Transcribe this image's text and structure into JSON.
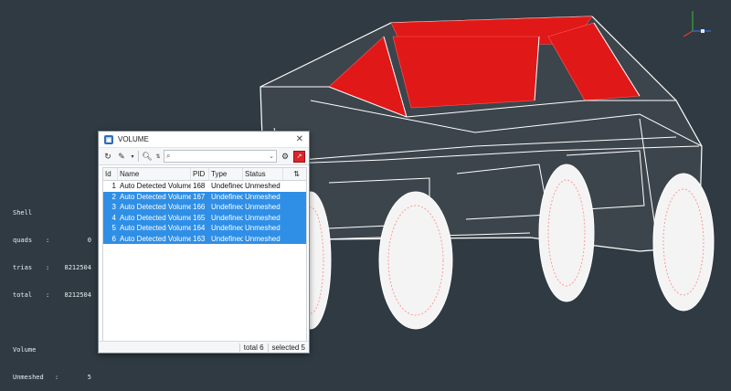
{
  "stats": {
    "shell_heading": "Shell",
    "rows": [
      {
        "key": "quads",
        "value": "0"
      },
      {
        "key": "trias",
        "value": "8212504"
      },
      {
        "key": "total",
        "value": "8212504"
      }
    ],
    "volume_heading": "Volume",
    "volume_rows": [
      {
        "key": "Unmeshed",
        "value": "5"
      }
    ]
  },
  "dialog": {
    "title": "VOLUME",
    "close_glyph": "✕",
    "columns": {
      "id": "Id",
      "name": "Name",
      "pid": "PID",
      "type": "Type",
      "status": "Status"
    },
    "rows": [
      {
        "id": "1",
        "name": "Auto Detected Volume",
        "pid": "168",
        "type": "Undefined",
        "status": "Unmeshed",
        "selected": false
      },
      {
        "id": "2",
        "name": "Auto Detected Volume",
        "pid": "167",
        "type": "Undefined",
        "status": "Unmeshed",
        "selected": true
      },
      {
        "id": "3",
        "name": "Auto Detected Volume",
        "pid": "166",
        "type": "Undefined",
        "status": "Unmeshed",
        "selected": true
      },
      {
        "id": "4",
        "name": "Auto Detected Volume",
        "pid": "165",
        "type": "Undefined",
        "status": "Unmeshed",
        "selected": true
      },
      {
        "id": "5",
        "name": "Auto Detected Volume",
        "pid": "164",
        "type": "Undefined",
        "status": "Unmeshed",
        "selected": true
      },
      {
        "id": "6",
        "name": "Auto Detected Volume",
        "pid": "163",
        "type": "Undefined",
        "status": "Unmeshed",
        "selected": true
      }
    ],
    "status_total": "total 6",
    "status_selected": "selected 5"
  },
  "colors": {
    "viewport_bg": "#2f3a42",
    "mesh_red": "#e01818",
    "wire_white": "#ffffff",
    "selection_blue": "#2f8fe6"
  }
}
